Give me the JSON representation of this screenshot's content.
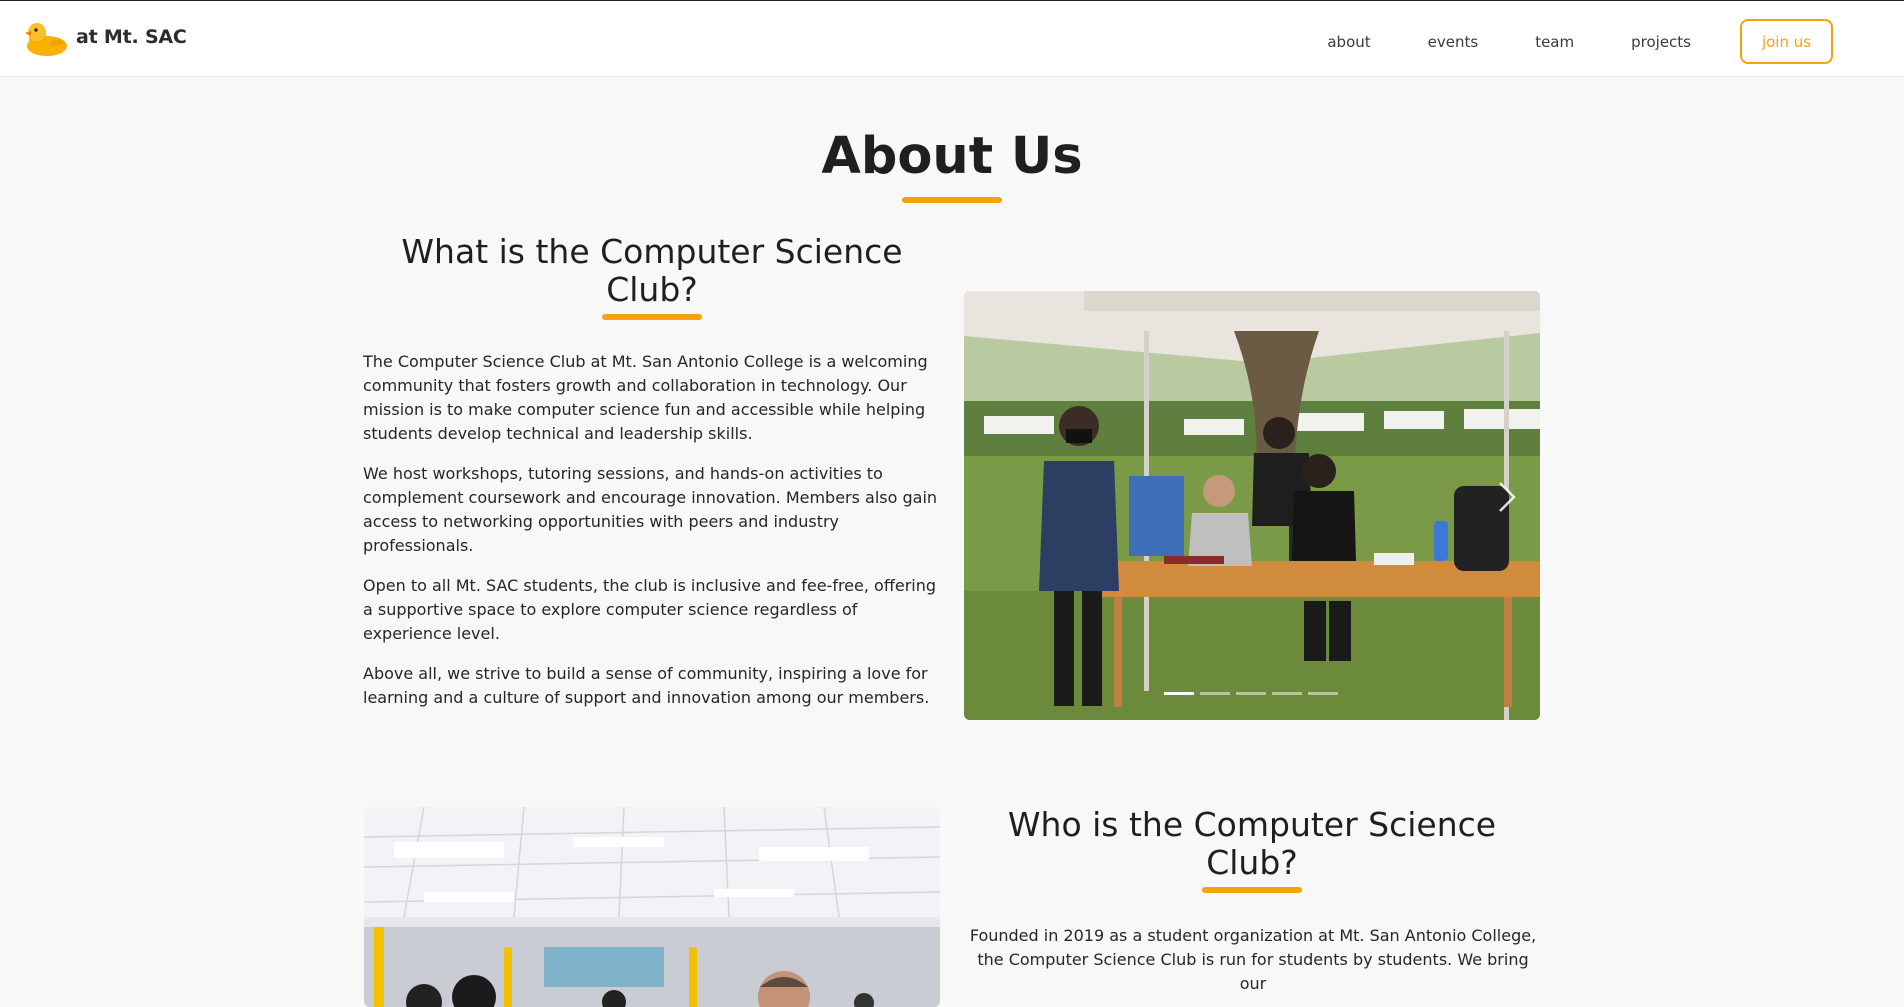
{
  "brand": {
    "logo_icon": "rubber-duck-icon",
    "text": "at Mt. SAC"
  },
  "nav": {
    "links": [
      "about",
      "events",
      "team",
      "projects"
    ],
    "cta": "join us"
  },
  "colors": {
    "accent": "#f5a30c",
    "background": "#f8f8f8",
    "text": "#1f1f1f"
  },
  "about": {
    "title": "About Us"
  },
  "what": {
    "title": "What is the Computer Science Club?",
    "paragraphs": [
      "The Computer Science Club at Mt. San Antonio College is a welcoming community that fosters growth and collaboration in technology. Our mission is to make computer science fun and accessible while helping students develop technical and leadership skills.",
      "We host workshops, tutoring sessions, and hands-on activities to complement coursework and encourage innovation. Members also gain access to networking opportunities with peers and industry professionals.",
      "Open to all Mt. SAC students, the club is inclusive and fee-free, offering a supportive space to explore computer science regardless of experience level.",
      "Above all, we strive to build a sense of community, inspiring a love for learning and a culture of support and innovation among our members."
    ],
    "carousel": {
      "next_icon": "chevron-right-icon",
      "slide_count": 5,
      "active_slide": 1
    }
  },
  "who": {
    "title": "Who is the Computer Science Club?",
    "text": "Founded in 2019 as a student organization at Mt. San Antonio College, the Computer Science Club is run for students by students. We bring our"
  }
}
